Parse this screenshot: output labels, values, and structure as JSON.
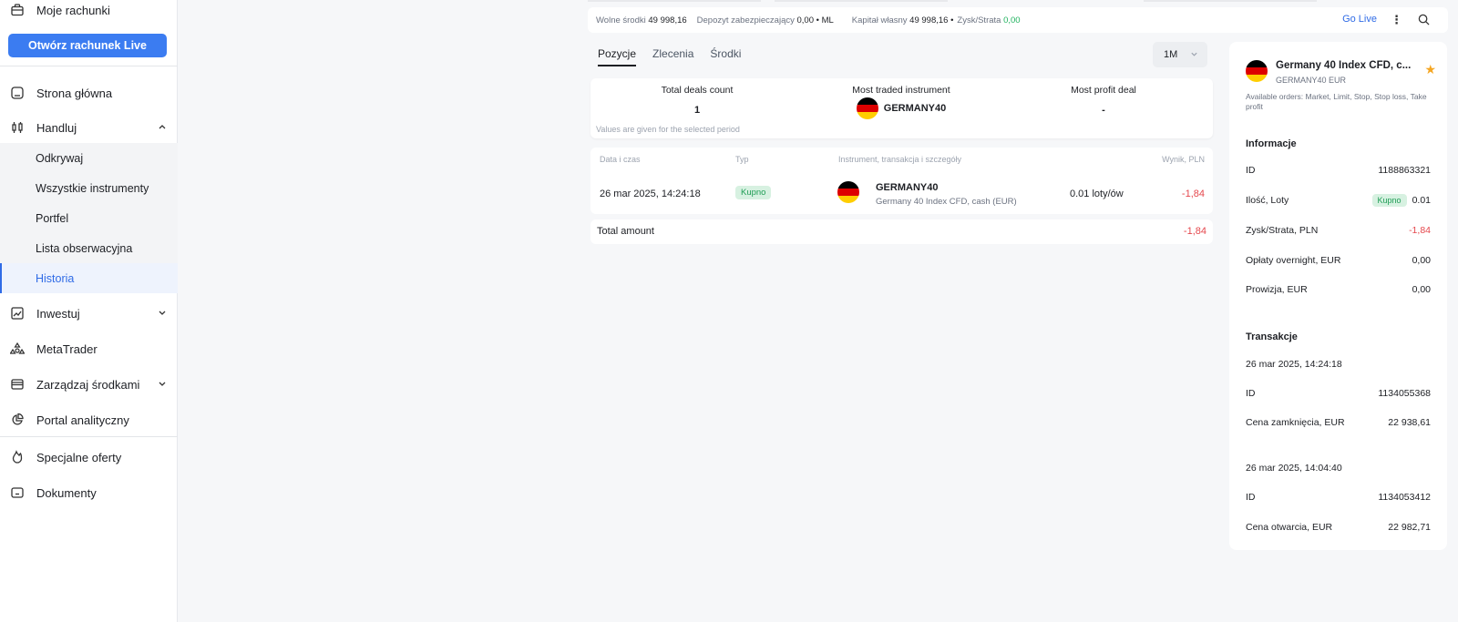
{
  "sidebar": {
    "my_accounts": "Moje rachunki",
    "open_live": "Otwórz rachunek Live",
    "home": "Strona główna",
    "trade": "Handluj",
    "trade_sub": [
      "Odkrywaj",
      "Wszystkie instrumenty",
      "Portfel",
      "Lista obserwacyjna",
      "Historia"
    ],
    "invest": "Inwestuj",
    "metatrader": "MetaTrader",
    "manage_funds": "Zarządzaj środkami",
    "analytics": "Portal analityczny",
    "special_offers": "Specjalne oferty",
    "documents": "Dokumenty"
  },
  "topbar": {
    "free_funds_label": "Wolne środki",
    "free_funds_value": "49 998,16",
    "margin_label": "Depozyt zabezpieczający",
    "margin_value": "0,00 • ML",
    "equity_label": "Kapitał własny",
    "equity_value": "49 998,16 •",
    "pnl_label": "Zysk/Strata",
    "pnl_value": "0,00",
    "go_live": "Go Live"
  },
  "tabs": [
    "Pozycje",
    "Zlecenia",
    "Środki"
  ],
  "period": "1M",
  "stats": {
    "total_deals_label": "Total deals count",
    "total_deals_value": "1",
    "most_traded_label": "Most traded instrument",
    "most_traded_value": "GERMANY40",
    "most_profit_label": "Most profit deal",
    "most_profit_value": "-",
    "note": "Values are given for the selected period"
  },
  "table": {
    "headers": {
      "date": "Data i czas",
      "type": "Typ",
      "instrument": "Instrument, transakcja i szczegóły",
      "result": "Wynik, PLN"
    },
    "row": {
      "date": "26 mar 2025, 14:24:18",
      "type": "Kupno",
      "symbol": "GERMANY40",
      "description": "Germany 40 Index CFD, cash (EUR)",
      "volume": "0.01 loty/ów",
      "result": "-1,84"
    },
    "total_label": "Total amount",
    "total_value": "-1,84"
  },
  "panel": {
    "title": "Germany 40 Index CFD, c...",
    "subtitle": "GERMANY40 EUR",
    "available_orders": "Available orders: Market, Limit, Stop, Stop loss, Take profit",
    "info_header": "Informacje",
    "id_label": "ID",
    "id_value": "1188863321",
    "qty_label": "Ilość, Loty",
    "qty_badge": "Kupno",
    "qty_value": "0.01",
    "pnl_label": "Zysk/Strata, PLN",
    "pnl_value": "-1,84",
    "overnight_label": "Opłaty overnight, EUR",
    "overnight_value": "0,00",
    "commission_label": "Prowizja, EUR",
    "commission_value": "0,00",
    "transactions_header": "Transakcje",
    "t1_date": "26 mar 2025, 14:24:18",
    "t1_id_label": "ID",
    "t1_id_value": "1134055368",
    "t1_price_label": "Cena zamknięcia, EUR",
    "t1_price_value": "22 938,61",
    "t2_date": "26 mar 2025, 14:04:40",
    "t2_id_label": "ID",
    "t2_id_value": "1134053412",
    "t2_price_label": "Cena otwarcia, EUR",
    "t2_price_value": "22 982,71"
  },
  "colors": {
    "accent": "#3b7cf1",
    "loss": "#e5484d",
    "gain": "#21b35f",
    "star": "#f5a623"
  }
}
